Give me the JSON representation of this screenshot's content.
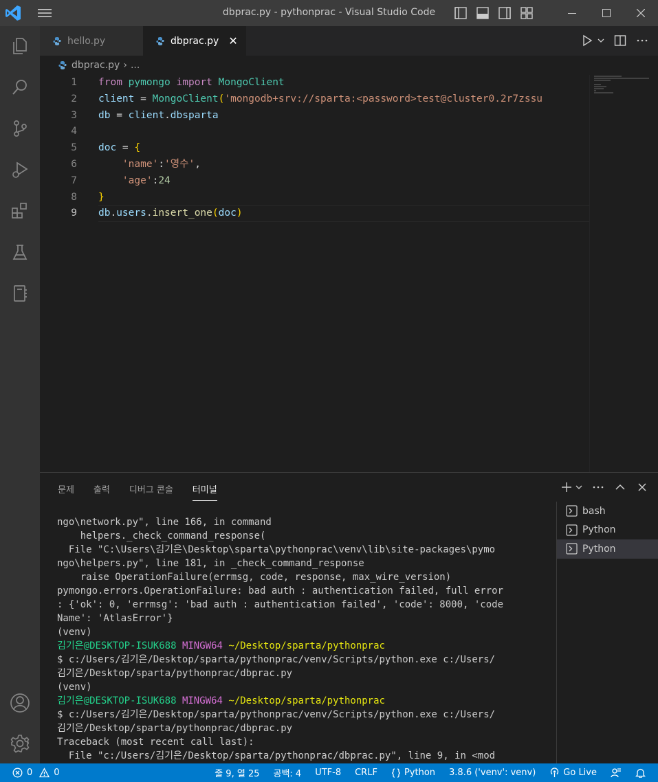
{
  "window": {
    "title": "dbprac.py - pythonprac - Visual Studio Code"
  },
  "tabs": [
    {
      "label": "hello.py",
      "active": false
    },
    {
      "label": "dbprac.py",
      "active": true,
      "close": "✕"
    }
  ],
  "breadcrumb": {
    "file": "dbprac.py",
    "separator": "›",
    "rest": "..."
  },
  "editor": {
    "line_numbers": [
      "1",
      "2",
      "3",
      "4",
      "5",
      "6",
      "7",
      "8",
      "9"
    ],
    "current_line": 9,
    "code": [
      [
        {
          "t": "from",
          "c": "kw"
        },
        {
          "t": " "
        },
        {
          "t": "pymongo",
          "c": "mod"
        },
        {
          "t": " "
        },
        {
          "t": "import",
          "c": "kw"
        },
        {
          "t": " "
        },
        {
          "t": "MongoClient",
          "c": "mod"
        }
      ],
      [
        {
          "t": "client",
          "c": "var"
        },
        {
          "t": " = "
        },
        {
          "t": "MongoClient",
          "c": "mod"
        },
        {
          "t": "(",
          "c": "br1"
        },
        {
          "t": "'mongodb+srv://sparta:<password>test@cluster0.2r7zssu",
          "c": "str"
        }
      ],
      [
        {
          "t": "db",
          "c": "var"
        },
        {
          "t": " = "
        },
        {
          "t": "client",
          "c": "var"
        },
        {
          "t": "."
        },
        {
          "t": "dbsparta",
          "c": "var"
        }
      ],
      [
        {
          "t": ""
        }
      ],
      [
        {
          "t": "doc",
          "c": "var"
        },
        {
          "t": " = "
        },
        {
          "t": "{",
          "c": "br1"
        }
      ],
      [
        {
          "t": "    "
        },
        {
          "t": "'name'",
          "c": "str"
        },
        {
          "t": ":"
        },
        {
          "t": "'영수'",
          "c": "str"
        },
        {
          "t": ","
        }
      ],
      [
        {
          "t": "    "
        },
        {
          "t": "'age'",
          "c": "str"
        },
        {
          "t": ":"
        },
        {
          "t": "24",
          "c": "num"
        }
      ],
      [
        {
          "t": "}",
          "c": "br1"
        }
      ],
      [
        {
          "t": "db",
          "c": "var"
        },
        {
          "t": "."
        },
        {
          "t": "users",
          "c": "var"
        },
        {
          "t": "."
        },
        {
          "t": "insert_one",
          "c": "fn"
        },
        {
          "t": "(",
          "c": "br1"
        },
        {
          "t": "doc",
          "c": "var"
        },
        {
          "t": ")",
          "c": "br1"
        }
      ]
    ]
  },
  "panel": {
    "tabs": [
      "문제",
      "출력",
      "디버그 콘솔",
      "터미널"
    ],
    "active_tab": "터미널",
    "terminal_lines": [
      [
        {
          "t": "ngo\\network.py\", line 166, in command"
        }
      ],
      [
        {
          "t": "    helpers._check_command_response("
        }
      ],
      [
        {
          "t": "  File \"C:\\Users\\김기은\\Desktop\\sparta\\pythonprac\\venv\\lib\\site-packages\\pymo"
        }
      ],
      [
        {
          "t": "ngo\\helpers.py\", line 181, in _check_command_response"
        }
      ],
      [
        {
          "t": "    raise OperationFailure(errmsg, code, response, max_wire_version)"
        }
      ],
      [
        {
          "t": "pymongo.errors.OperationFailure: bad auth : authentication failed, full error"
        }
      ],
      [
        {
          "t": ": {'ok': 0, 'errmsg': 'bad auth : authentication failed', 'code': 8000, 'code"
        }
      ],
      [
        {
          "t": "Name': 'AtlasError'}"
        }
      ],
      [
        {
          "t": "(venv)"
        }
      ],
      [
        {
          "t": "김기은@DESKTOP-ISUK688",
          "c": "t-green"
        },
        {
          "t": " "
        },
        {
          "t": "MINGW64",
          "c": "t-mag"
        },
        {
          "t": " "
        },
        {
          "t": "~/Desktop/sparta/pythonprac",
          "c": "t-yel"
        }
      ],
      [
        {
          "t": "$ c:/Users/김기은/Desktop/sparta/pythonprac/venv/Scripts/python.exe c:/Users/"
        }
      ],
      [
        {
          "t": "김기은/Desktop/sparta/pythonprac/dbprac.py"
        }
      ],
      [
        {
          "t": "(venv)"
        }
      ],
      [
        {
          "t": "김기은@DESKTOP-ISUK688",
          "c": "t-green"
        },
        {
          "t": " "
        },
        {
          "t": "MINGW64",
          "c": "t-mag"
        },
        {
          "t": " "
        },
        {
          "t": "~/Desktop/sparta/pythonprac",
          "c": "t-yel"
        }
      ],
      [
        {
          "t": "$ c:/Users/김기은/Desktop/sparta/pythonprac/venv/Scripts/python.exe c:/Users/"
        }
      ],
      [
        {
          "t": "김기은/Desktop/sparta/pythonprac/dbprac.py"
        }
      ],
      [
        {
          "t": "Traceback (most recent call last):"
        }
      ],
      [
        {
          "t": "  File \"c:/Users/김기은/Desktop/sparta/pythonprac/dbprac.py\", line 9, in <mod"
        }
      ]
    ],
    "terminals": [
      {
        "label": "bash",
        "selected": false
      },
      {
        "label": "Python",
        "selected": false
      },
      {
        "label": "Python",
        "selected": true
      }
    ]
  },
  "statusbar": {
    "errors": "0",
    "warnings": "0",
    "position": "줄 9, 열 25",
    "indent": "공백: 4",
    "encoding": "UTF-8",
    "eol": "CRLF",
    "language": "Python",
    "interpreter": "3.8.6 ('venv': venv)",
    "go_live": "Go Live"
  },
  "colors": {
    "accent": "#007acc",
    "titlebar": "#3c3c3c",
    "activitybar": "#333333",
    "editor_bg": "#1e1e1e"
  },
  "icons": {
    "activity": [
      "explorer-icon",
      "search-icon",
      "source-control-icon",
      "run-debug-icon",
      "extensions-icon",
      "testing-icon",
      "notebook-icon",
      "account-icon",
      "settings-gear-icon"
    ]
  }
}
